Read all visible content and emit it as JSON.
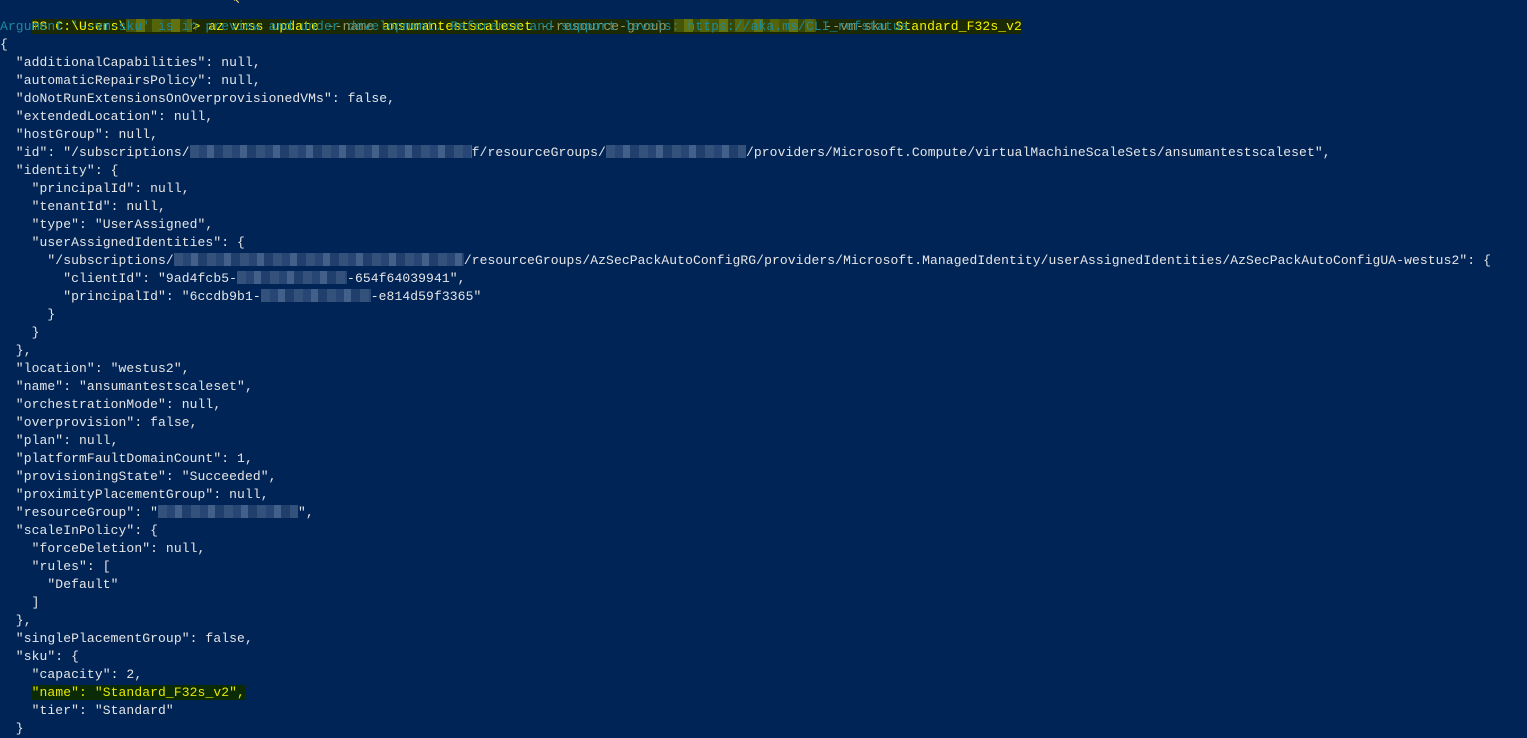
{
  "window": {
    "type": "PowerShell console"
  },
  "command": {
    "prompt_prefix": "PS C:\\Users\\",
    "prompt_suffix": "> ",
    "cmd": "az vmss update",
    "arg_name_flag": "--name",
    "arg_name_value": "ansumantestscaleset",
    "arg_rg_flag": "--resource-group",
    "arg_sku_flag": "--vm-sku",
    "arg_sku_value": "Standard_F32s_v2"
  },
  "warning": "Argument '--vm-sku' is in preview and under development. Reference and support levels: https://aka.ms/CLI_refstatus",
  "output_lines": [
    "{",
    "  \"additionalCapabilities\": null,",
    "  \"automaticRepairsPolicy\": null,",
    "  \"doNotRunExtensionsOnOverprovisionedVMs\": false,",
    "  \"extendedLocation\": null,",
    "  \"hostGroup\": null,",
    "ID_LINE",
    "  \"identity\": {",
    "    \"principalId\": null,",
    "    \"tenantId\": null,",
    "    \"type\": \"UserAssigned\",",
    "    \"userAssignedIdentities\": {",
    "UAI_LINE",
    "CLIENT_LINE",
    "PRINCIPAL_LINE",
    "      }",
    "    }",
    "  },",
    "  \"location\": \"westus2\",",
    "  \"name\": \"ansumantestscaleset\",",
    "  \"orchestrationMode\": null,",
    "  \"overprovision\": false,",
    "  \"plan\": null,",
    "  \"platformFaultDomainCount\": 1,",
    "  \"provisioningState\": \"Succeeded\",",
    "  \"proximityPlacementGroup\": null,",
    "RG_LINE",
    "  \"scaleInPolicy\": {",
    "    \"forceDeletion\": null,",
    "    \"rules\": [",
    "      \"Default\"",
    "    ]",
    "  },",
    "  \"singlePlacementGroup\": false,",
    "  \"sku\": {",
    "    \"capacity\": 2,",
    "SKU_NAME_LINE",
    "    \"tier\": \"Standard\"",
    "  }"
  ],
  "special": {
    "id_prefix": "  \"id\": \"/subscriptions/",
    "id_mid": "f/resourceGroups/",
    "id_suffix": "/providers/Microsoft.Compute/virtualMachineScaleSets/ansumantestscaleset\",",
    "uai_prefix": "      \"/subscriptions/",
    "uai_suffix": "/resourceGroups/AzSecPackAutoConfigRG/providers/Microsoft.ManagedIdentity/userAssignedIdentities/AzSecPackAutoConfigUA-westus2\": {",
    "client_prefix": "        \"clientId\": \"9ad4fcb5-",
    "client_suffix": "-654f64039941\",",
    "principal_prefix": "        \"principalId\": \"6ccdb9b1-",
    "principal_suffix": "-e814d59f3365\"",
    "rg_prefix": "  \"resourceGroup\": \"",
    "rg_suffix": "\",",
    "sku_name_indent": "    ",
    "sku_name_text": "\"name\": \"Standard_F32s_v2\","
  },
  "colors": {
    "background": "#012456",
    "prompt": "#f2f200",
    "warning": "#1d8a9a",
    "text": "#e6e6e6",
    "highlight_bg": "#0b2a06"
  }
}
